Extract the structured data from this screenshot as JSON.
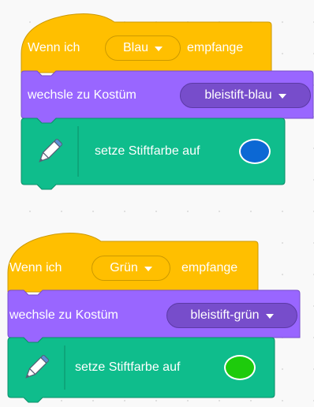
{
  "colors": {
    "event": "#ffbf00",
    "event_border": "#cc9900",
    "looks": "#9966ff",
    "looks_border": "#774dcb",
    "pen": "#0fbd8c",
    "pen_border": "#0b8e69"
  },
  "scripts": [
    {
      "hat": {
        "prefix": "Wenn ich",
        "message": "Blau",
        "suffix": "empfange"
      },
      "costume": {
        "label": "wechsle zu Kostüm",
        "value": "bleistift-blau"
      },
      "pen": {
        "label": "setze Stiftfarbe auf",
        "color": "#0c68d4",
        "icon": "pen-icon"
      }
    },
    {
      "hat": {
        "prefix": "Wenn ich",
        "message": "Grün",
        "suffix": "empfange"
      },
      "costume": {
        "label": "wechsle zu Kostüm",
        "value": "bleistift-grün"
      },
      "pen": {
        "label": "setze Stiftfarbe auf",
        "color": "#1ecb0c",
        "icon": "pen-icon"
      }
    }
  ]
}
